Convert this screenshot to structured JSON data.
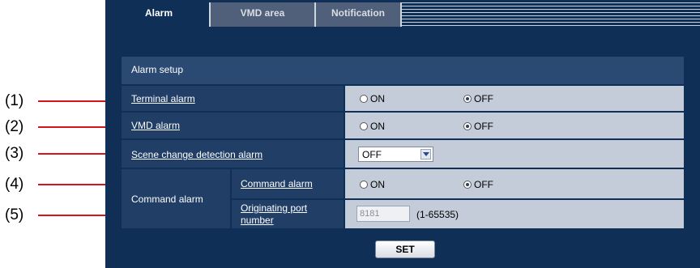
{
  "tabs": [
    {
      "label": "Alarm",
      "active": true
    },
    {
      "label": "VMD area",
      "active": false
    },
    {
      "label": "Notification",
      "active": false
    }
  ],
  "section_title": "Alarm setup",
  "callouts": [
    "(1)",
    "(2)",
    "(3)",
    "(4)",
    "(5)"
  ],
  "rows": {
    "terminal_alarm": {
      "label": "Terminal alarm",
      "on_label": "ON",
      "off_label": "OFF",
      "selected": "OFF"
    },
    "vmd_alarm": {
      "label": "VMD alarm",
      "on_label": "ON",
      "off_label": "OFF",
      "selected": "OFF"
    },
    "scene_change": {
      "label": "Scene change detection alarm",
      "value": "OFF"
    },
    "command_group_label": "Command alarm",
    "command_alarm": {
      "label": "Command alarm",
      "on_label": "ON",
      "off_label": "OFF",
      "selected": "OFF"
    },
    "originating_port": {
      "label_line1": "Originating port",
      "label_line2": "number",
      "value": "8181",
      "range": "(1-65535)"
    }
  },
  "set_button": "SET",
  "colors": {
    "panel": "#102f56",
    "label_cell": "#203e66",
    "value_cell": "#c3ccd8",
    "callout_line": "#d8121a"
  }
}
